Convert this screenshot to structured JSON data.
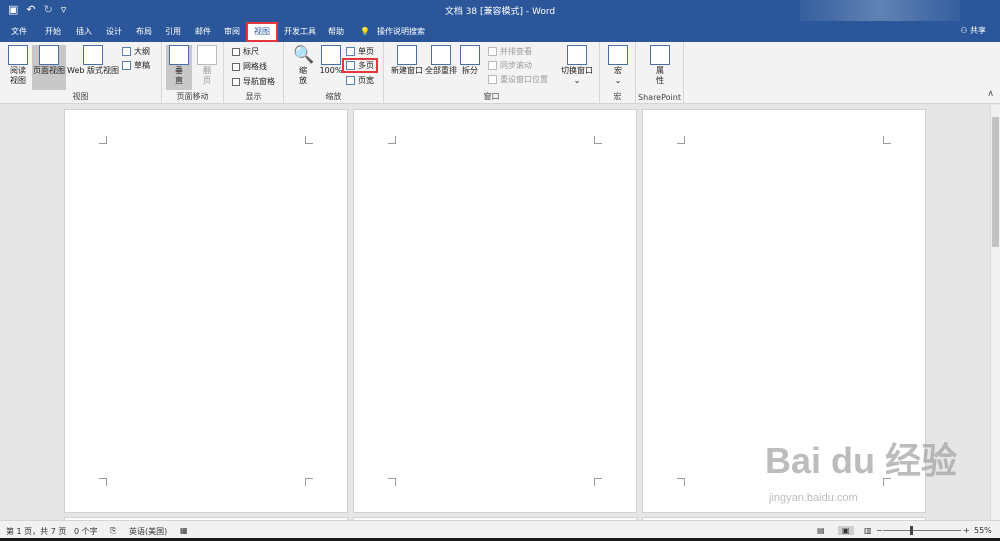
{
  "titlebar": {
    "title": "文档 38 [兼容模式]  -  Word",
    "qat_save_icon": "save-icon",
    "qat_undo": "↶",
    "qat_redo": "↻",
    "qat_more": "▿"
  },
  "tabs": [
    {
      "label": "文件"
    },
    {
      "label": "开始"
    },
    {
      "label": "插入"
    },
    {
      "label": "设计"
    },
    {
      "label": "布局"
    },
    {
      "label": "引用"
    },
    {
      "label": "邮件"
    },
    {
      "label": "审阅"
    },
    {
      "label": "视图",
      "active": true
    },
    {
      "label": "开发工具"
    },
    {
      "label": "帮助"
    },
    {
      "label": "操作说明搜索"
    }
  ],
  "share_label": "共享",
  "ribbon": {
    "views": {
      "read": "阅读\n视图",
      "print": "页面视图",
      "web": "Web 版式视图",
      "outline": "大纲",
      "draft": "草稿",
      "group": "视图"
    },
    "pagemove": {
      "vertical": "垂\n直",
      "side": "翻\n页",
      "group": "页面移动"
    },
    "show": {
      "ruler": "标尺",
      "gridlines": "网格线",
      "navpane": "导航窗格",
      "group": "显示"
    },
    "zoom": {
      "zoom": "缩\n放",
      "hundred": "100%",
      "onepage": "单页",
      "multipage": "多页",
      "pagewidth": "页宽",
      "group": "缩放"
    },
    "window": {
      "newwindow": "新建窗口",
      "arrangeall": "全部重排",
      "split": "拆分",
      "sidebyside": "并排查看",
      "syncscroll": "同步滚动",
      "resetpos": "重设窗口位置",
      "switch": "切换窗口",
      "group": "窗口"
    },
    "macro": {
      "macros": "宏",
      "group": "宏"
    },
    "sharepoint": {
      "props": "属\n性",
      "group": "SharePoint"
    }
  },
  "status": {
    "page": "第 1 页，共 7 页",
    "words": "0 个字",
    "lang": "英语(美国)",
    "zoom": "55%",
    "minus": "−",
    "plus": "+"
  },
  "watermark": {
    "big": "Bai du 经验",
    "small": "jingyan.baidu.com"
  }
}
